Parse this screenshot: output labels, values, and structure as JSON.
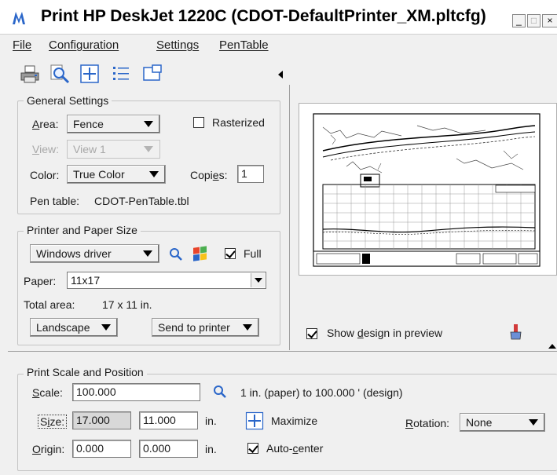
{
  "window": {
    "title": "Print HP DeskJet 1220C (CDOT-DefaultPrinter_XM.pltcfg)",
    "buttons": {
      "minimize": "_",
      "maximize": "□",
      "close": "×"
    }
  },
  "menu": [
    "File",
    "Configuration",
    "Settings",
    "PenTable"
  ],
  "toolbar": {
    "icons": [
      "printer-icon",
      "preview-magnifier-icon",
      "fit-crosshair-icon",
      "list-icon",
      "layout-icon"
    ]
  },
  "general": {
    "label": "General Settings",
    "area_label": "Area:",
    "area_value": "Fence",
    "rasterized_label": "Rasterized",
    "rasterized_checked": false,
    "view_label": "View:",
    "view_value": "View 1",
    "color_label": "Color:",
    "color_value": "True Color",
    "copies_label": "Copies:",
    "copies_value": "1",
    "pentable_label": "Pen table:",
    "pentable_value": "CDOT-PenTable.tbl"
  },
  "printer": {
    "label": "Printer and Paper Size",
    "driver_value": "Windows driver",
    "full_label": "Full",
    "full_checked": true,
    "paper_label": "Paper:",
    "paper_value": "11x17",
    "total_label": "Total area:",
    "total_value": "17 x 11 in.",
    "orientation_value": "Landscape",
    "send_value": "Send to printer"
  },
  "preview": {
    "show_label": "Show design in preview",
    "show_checked": true
  },
  "scale": {
    "label": "Print Scale and Position",
    "scale_label": "Scale:",
    "scale_value": "100.000",
    "scale_text": "1 in. (paper) to 100.000 ' (design)",
    "size_label": "Size:",
    "size_w": "17.000",
    "size_h": "11.000",
    "size_unit": "in.",
    "maximize_label": "Maximize",
    "rotation_label": "Rotation:",
    "rotation_value": "None",
    "origin_label": "Origin:",
    "origin_x": "0.000",
    "origin_y": "0.000",
    "origin_unit": "in.",
    "autocenter_label": "Auto-center",
    "autocenter_checked": true
  },
  "colors": {
    "accent": "#2a66c9",
    "title_icon": "#2a66c9"
  }
}
